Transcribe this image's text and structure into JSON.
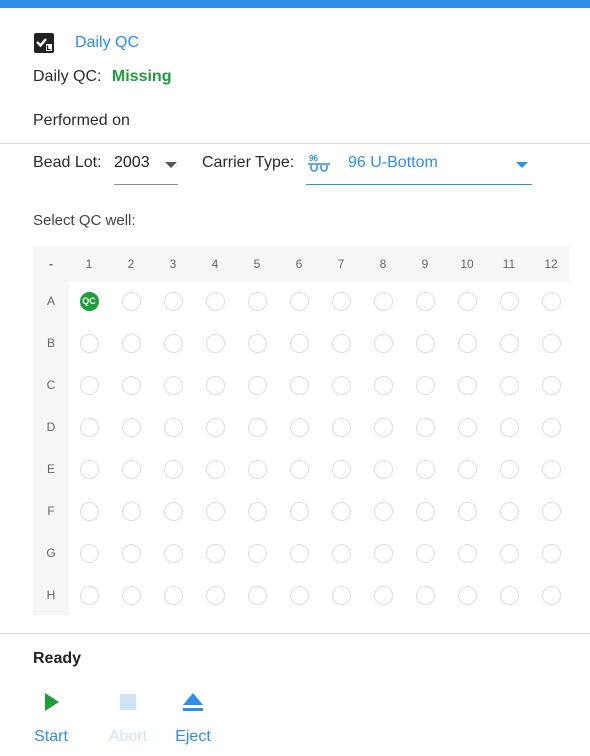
{
  "header": {
    "title": "Daily QC",
    "icon": "checklist-icon"
  },
  "qc": {
    "label": "Daily QC:",
    "status": "Missing",
    "status_color": "#1f9d3a"
  },
  "performed": {
    "label": "Performed on"
  },
  "bead_lot": {
    "label": "Bead Lot:",
    "value": "2003"
  },
  "carrier": {
    "label": "Carrier Type:",
    "value": "96 U-Bottom",
    "icon": "plate-icon"
  },
  "plate": {
    "prompt": "Select QC well:",
    "corner": "-",
    "columns": [
      "1",
      "2",
      "3",
      "4",
      "5",
      "6",
      "7",
      "8",
      "9",
      "10",
      "11",
      "12"
    ],
    "rows": [
      "A",
      "B",
      "C",
      "D",
      "E",
      "F",
      "G",
      "H"
    ],
    "selected_well": "A1",
    "selected_badge": "QC"
  },
  "status": {
    "text": "Ready"
  },
  "actions": {
    "start": "Start",
    "abort": "Abort",
    "eject": "Eject"
  },
  "colors": {
    "accent": "#2f8ee6",
    "success": "#1f9d3a",
    "disabled": "#cfe3f6"
  }
}
